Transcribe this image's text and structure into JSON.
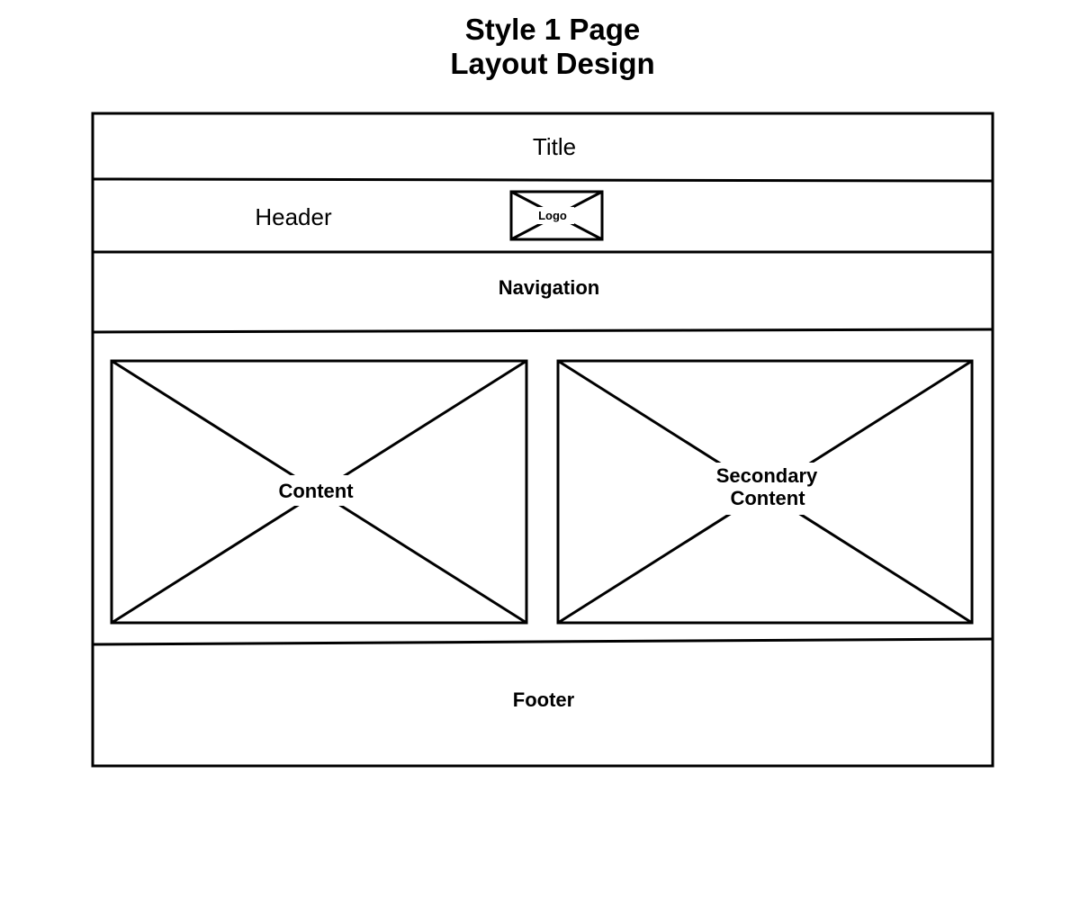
{
  "diagram": {
    "title_line1": "Style 1 Page",
    "title_line2": "Layout Design",
    "title_bar_label": "Title",
    "header_label": "Header",
    "logo_label": "Logo",
    "navigation_label": "Navigation",
    "content_label": "Content",
    "secondary_content_line1": "Secondary",
    "secondary_content_line2": "Content",
    "footer_label": "Footer"
  }
}
